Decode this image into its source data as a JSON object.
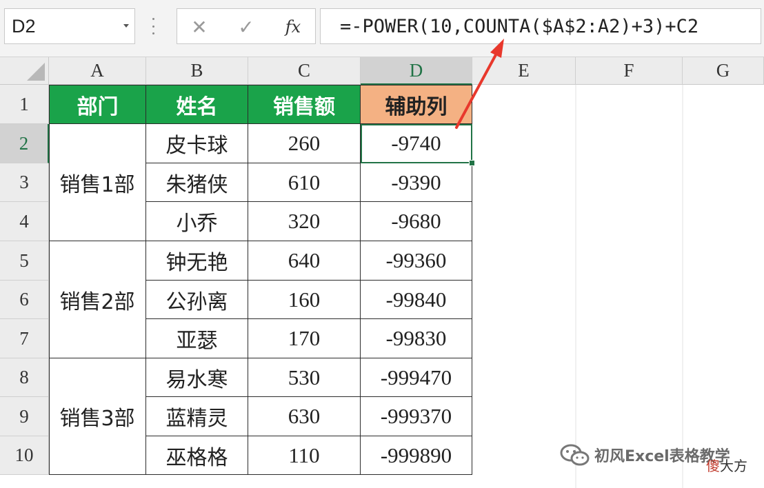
{
  "formula_bar": {
    "name_box": "D2",
    "cancel_icon": "✕",
    "enter_icon": "✓",
    "function_icon": "fx",
    "formula": "=-POWER(10,COUNTA($A$2:A2)+3)+C2"
  },
  "columns": [
    "A",
    "B",
    "C",
    "D",
    "E",
    "F",
    "G"
  ],
  "rows": [
    "1",
    "2",
    "3",
    "4",
    "5",
    "6",
    "7",
    "8",
    "9",
    "10"
  ],
  "selected_cell": "D2",
  "header_row": [
    "部门",
    "姓名",
    "销售额",
    "辅助列"
  ],
  "colors": {
    "header_green": "#1aa34a",
    "header_orange": "#f4b183",
    "selection_green": "#217346",
    "arrow_red": "#e8382c"
  },
  "groups": [
    {
      "dept": "销售1部"
    },
    {
      "dept": "销售2部"
    },
    {
      "dept": "销售3部"
    }
  ],
  "records": [
    {
      "name": "皮卡球",
      "sales": "260",
      "helper": "-9740"
    },
    {
      "name": "朱猪侠",
      "sales": "610",
      "helper": "-9390"
    },
    {
      "name": "小乔",
      "sales": "320",
      "helper": "-9680"
    },
    {
      "name": "钟无艳",
      "sales": "640",
      "helper": "-99360"
    },
    {
      "name": "公孙离",
      "sales": "160",
      "helper": "-99840"
    },
    {
      "name": "亚瑟",
      "sales": "170",
      "helper": "-99830"
    },
    {
      "name": "易水寒",
      "sales": "530",
      "helper": "-999470"
    },
    {
      "name": "蓝精灵",
      "sales": "630",
      "helper": "-999370"
    },
    {
      "name": "巫格格",
      "sales": "110",
      "helper": "-999890"
    }
  ],
  "watermark": {
    "channel": "初风Excel表格教学",
    "brand_red": "傻",
    "brand_rest": "大方"
  }
}
